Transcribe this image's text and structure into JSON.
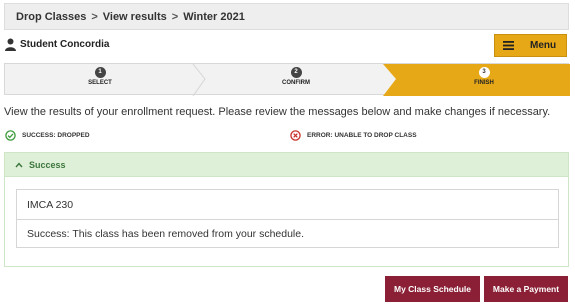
{
  "breadcrumb": {
    "items": [
      "Drop Classes",
      "View results",
      "Winter 2021"
    ],
    "separator": ">"
  },
  "user": {
    "name": "Student Concordia",
    "icon": "person-icon"
  },
  "menu": {
    "label": "Menu",
    "icon": "hamburger-icon"
  },
  "steps": [
    {
      "number": "1",
      "label": "SELECT",
      "state": "done"
    },
    {
      "number": "2",
      "label": "CONFIRM",
      "state": "done"
    },
    {
      "number": "3",
      "label": "FINISH",
      "state": "active"
    }
  ],
  "intro_text": "View the results of your enrollment request.  Please review the messages below and make changes if necessary.",
  "status": {
    "success": {
      "label": "SUCCESS: DROPPED",
      "icon": "check-circle-icon",
      "color": "#3c9a3c"
    },
    "error": {
      "label": "ERROR: UNABLE TO DROP CLASS",
      "icon": "x-circle-icon",
      "color": "#c9302c"
    }
  },
  "panel": {
    "title": "Success",
    "class_name": "IMCA 230",
    "message": "Success: This class has been removed from your schedule."
  },
  "buttons": {
    "schedule_label": "My Class Schedule",
    "payment_label": "Make a Payment"
  },
  "colors": {
    "accent": "#e6a817",
    "brand": "#8a1f35",
    "success_bg": "#dff0d8",
    "success_text": "#3c763d"
  }
}
